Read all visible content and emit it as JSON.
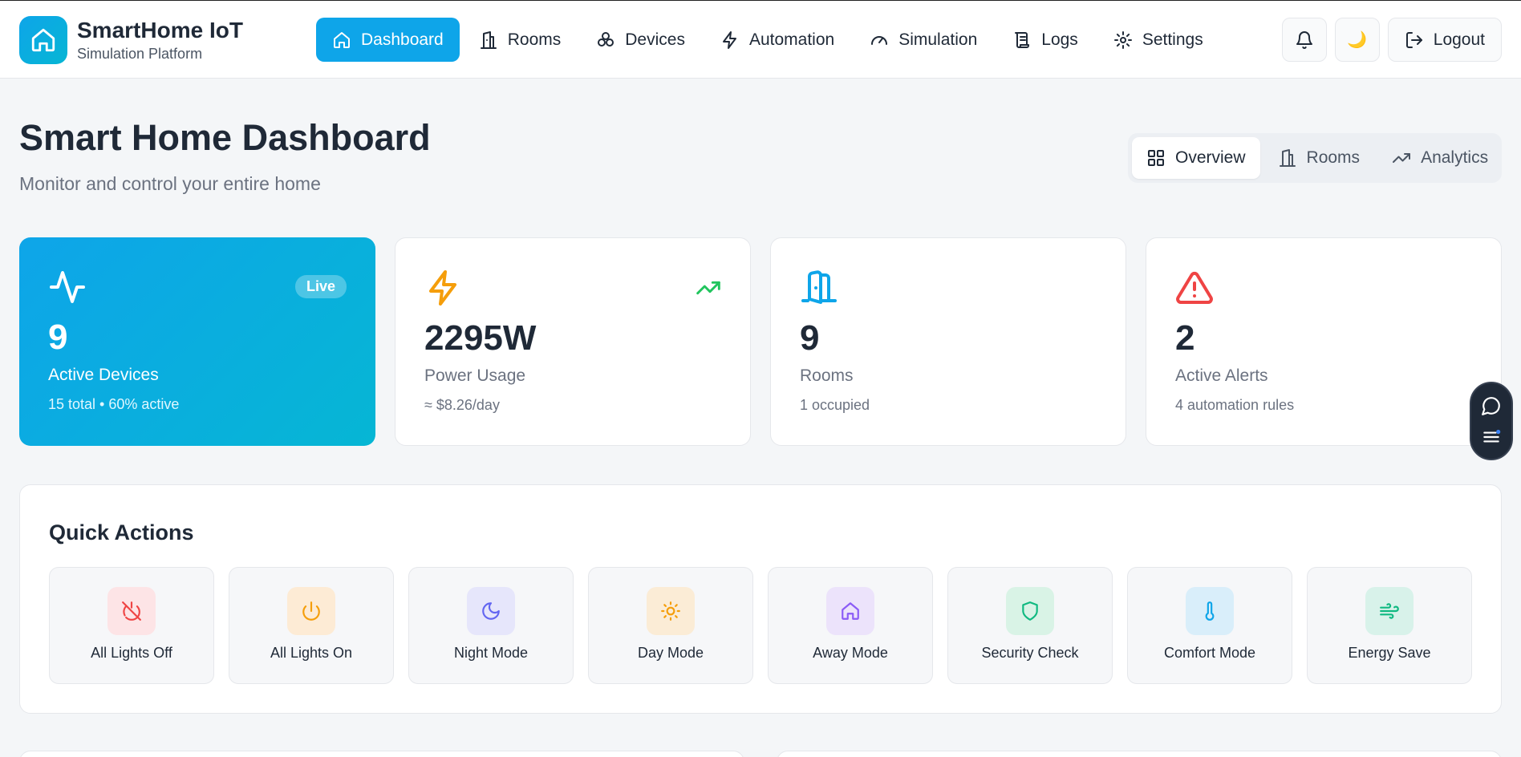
{
  "brand": {
    "title": "SmartHome IoT",
    "subtitle": "Simulation Platform"
  },
  "nav": {
    "items": [
      {
        "label": "Dashboard",
        "icon": "home-icon"
      },
      {
        "label": "Rooms",
        "icon": "building-icon"
      },
      {
        "label": "Devices",
        "icon": "cpu-cluster-icon"
      },
      {
        "label": "Automation",
        "icon": "lightning-icon"
      },
      {
        "label": "Simulation",
        "icon": "gauge-icon"
      },
      {
        "label": "Logs",
        "icon": "scroll-icon"
      },
      {
        "label": "Settings",
        "icon": "gear-icon"
      }
    ],
    "active": "Dashboard"
  },
  "header_actions": {
    "theme_glyph": "🌙",
    "logout_label": "Logout"
  },
  "page": {
    "title": "Smart Home Dashboard",
    "subtitle": "Monitor and control your entire home"
  },
  "view_tabs": [
    {
      "label": "Overview",
      "icon": "grid-icon"
    },
    {
      "label": "Rooms",
      "icon": "building-icon"
    },
    {
      "label": "Analytics",
      "icon": "trending-up-icon"
    }
  ],
  "stats": {
    "devices": {
      "badge": "Live",
      "value": "9",
      "label": "Active Devices",
      "note": "15 total • 60% active"
    },
    "power": {
      "value": "2295W",
      "label": "Power Usage",
      "note": "≈ $8.26/day"
    },
    "rooms": {
      "value": "9",
      "label": "Rooms",
      "note": "1 occupied"
    },
    "alerts": {
      "value": "2",
      "label": "Active Alerts",
      "note": "4 automation rules"
    }
  },
  "quick_actions": {
    "title": "Quick Actions",
    "items": [
      {
        "label": "All Lights Off",
        "icon": "power-off-icon"
      },
      {
        "label": "All Lights On",
        "icon": "power-icon"
      },
      {
        "label": "Night Mode",
        "icon": "moon-icon"
      },
      {
        "label": "Day Mode",
        "icon": "sun-icon"
      },
      {
        "label": "Away Mode",
        "icon": "home-icon"
      },
      {
        "label": "Security Check",
        "icon": "shield-icon"
      },
      {
        "label": "Comfort Mode",
        "icon": "thermometer-icon"
      },
      {
        "label": "Energy Save",
        "icon": "wind-icon"
      }
    ]
  },
  "colors": {
    "accent": "#0ea5e9",
    "accent_secondary": "#06b6d4",
    "power": "#f59e0b",
    "alert": "#ef4444",
    "trend": "#22c55e"
  }
}
